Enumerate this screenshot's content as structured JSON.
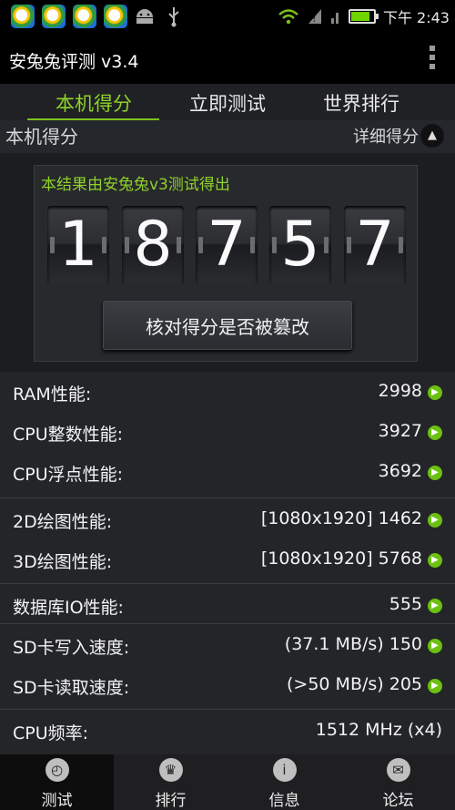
{
  "status": {
    "time": "下午 2:43"
  },
  "app": {
    "title": "安兔兔评测 v3.4"
  },
  "tabs": [
    "本机得分",
    "立即测试",
    "世界排行"
  ],
  "section": {
    "title": "本机得分",
    "detail_label": "详细得分",
    "detail_icon": "chevron-up-icon"
  },
  "score": {
    "caption": "本结果由安兔兔v3测试得出",
    "digits": [
      "1",
      "8",
      "7",
      "5",
      "7"
    ],
    "verify_label": "核对得分是否被篡改"
  },
  "stats": [
    {
      "label": "RAM性能:",
      "value": "2998",
      "arrow": true
    },
    {
      "label": "CPU整数性能:",
      "value": "3927",
      "arrow": true
    },
    {
      "label": "CPU浮点性能:",
      "value": "3692",
      "arrow": true
    },
    {
      "label": "2D绘图性能:",
      "value": "[1080x1920] 1462",
      "arrow": true
    },
    {
      "label": "3D绘图性能:",
      "value": "[1080x1920] 5768",
      "arrow": true
    },
    {
      "label": "数据库IO性能:",
      "value": "555",
      "arrow": true
    },
    {
      "label": "SD卡写入速度:",
      "value": "(37.1 MB/s)  150",
      "arrow": true
    },
    {
      "label": "SD卡读取速度:",
      "value": "(>50 MB/s)  205",
      "arrow": true
    },
    {
      "label": "CPU频率:",
      "value": "1512 MHz (x4)",
      "arrow": false
    }
  ],
  "bottom_nav": [
    {
      "label": "测试",
      "icon": "stopwatch-icon"
    },
    {
      "label": "排行",
      "icon": "trophy-icon"
    },
    {
      "label": "信息",
      "icon": "info-icon"
    },
    {
      "label": "论坛",
      "icon": "forum-icon"
    }
  ],
  "colors": {
    "accent": "#8fd22a",
    "background": "#1b1d20"
  }
}
